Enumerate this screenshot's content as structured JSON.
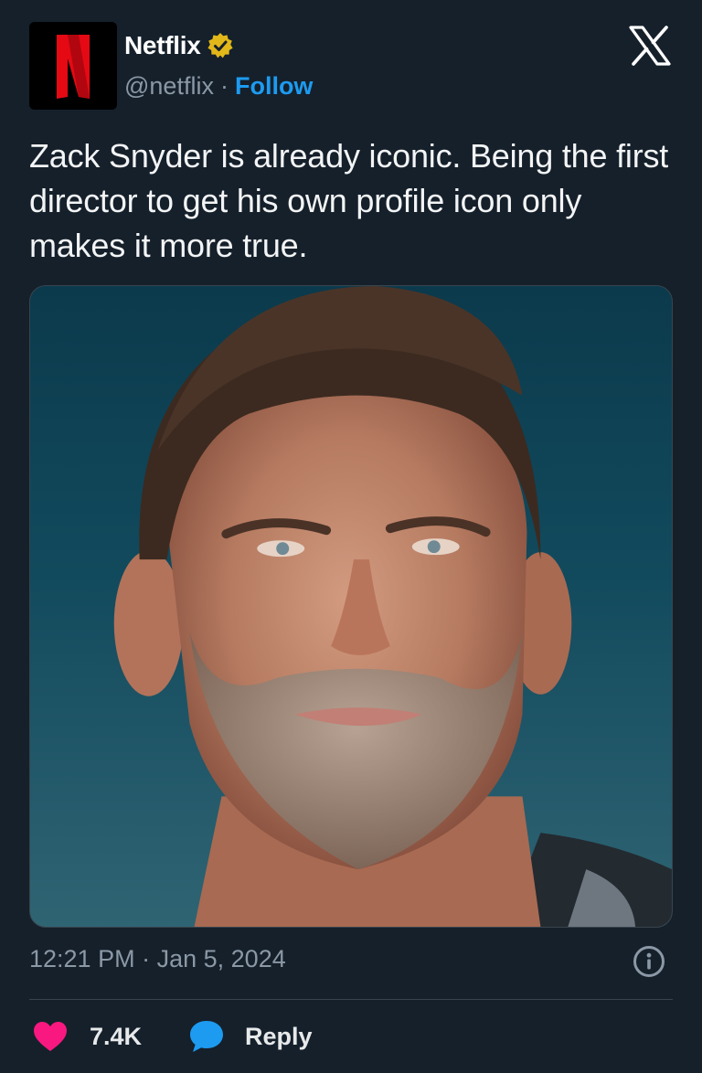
{
  "account": {
    "display_name": "Netflix",
    "handle": "@netflix",
    "separator": "·",
    "follow_label": "Follow",
    "verified_badge_color": "#e2b719"
  },
  "brand": {
    "logo_letter": "N",
    "logo_color": "#e50914",
    "platform_icon": "x-logo-icon"
  },
  "tweet": {
    "text": "Zack Snyder is already iconic. Being the first director to get his own profile icon only makes it more true.",
    "media_icon": "portrait-photo"
  },
  "meta": {
    "time": "12:21 PM",
    "separator": "·",
    "date": "Jan 5, 2024",
    "info_icon": "info-icon"
  },
  "actions": {
    "like_count": "7.4K",
    "like_color": "#f91880",
    "reply_label": "Reply",
    "reply_color": "#1d9bf0"
  }
}
